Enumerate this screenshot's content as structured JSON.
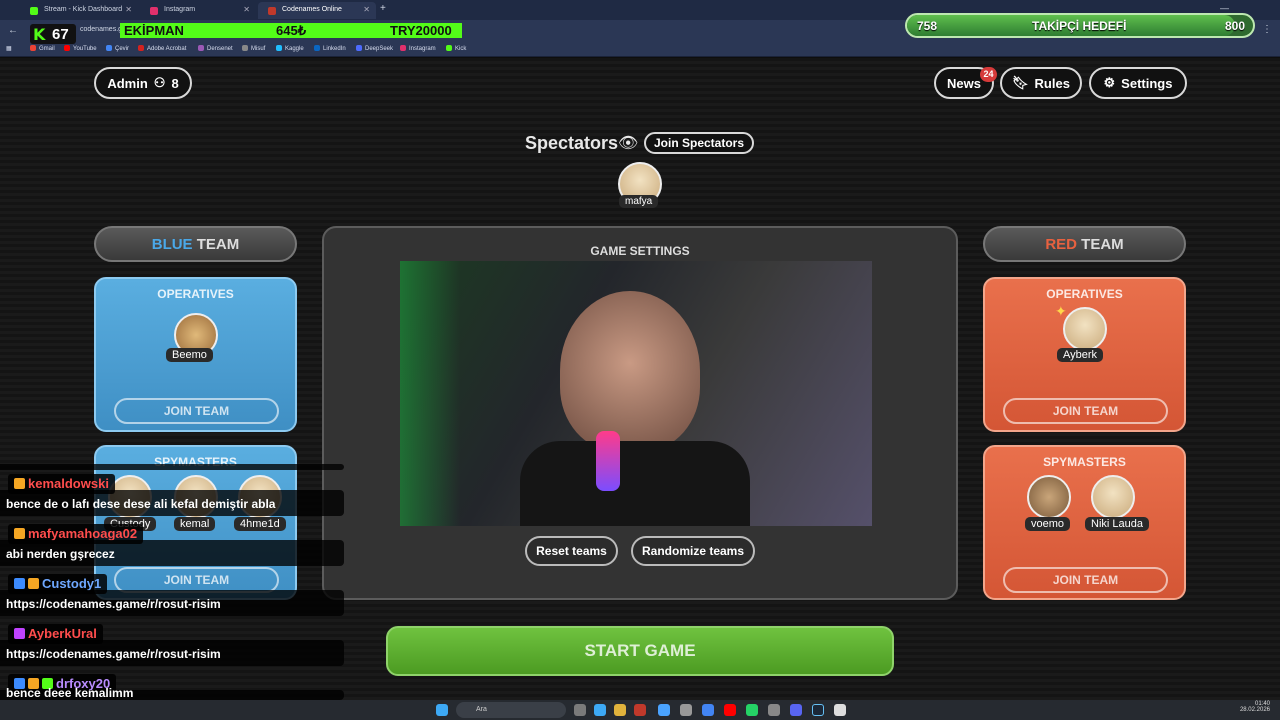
{
  "browser": {
    "tabs": [
      {
        "title": "Stream - Kick Dashboard",
        "color": "#53fc18"
      },
      {
        "title": "Instagram",
        "color": "#e1306c"
      },
      {
        "title": "Codenames Online",
        "color": "#c0392b"
      }
    ],
    "address_partial": "codenames.g",
    "bookmarks": [
      {
        "label": "Gmail",
        "color": "#ea4335"
      },
      {
        "label": "YouTube",
        "color": "#ff0000"
      },
      {
        "label": "Çevir",
        "color": "#4285f4"
      },
      {
        "label": "Adobe Acrobat",
        "color": "#d4221f"
      },
      {
        "label": "Densenet",
        "color": "#9b59b6"
      },
      {
        "label": "Misuf",
        "color": "#888888"
      },
      {
        "label": "Kaggle",
        "color": "#20beff"
      },
      {
        "label": "LinkedIn",
        "color": "#0a66c2"
      },
      {
        "label": "DeepSeek",
        "color": "#4d6bfe"
      },
      {
        "label": "Instagram",
        "color": "#e1306c"
      },
      {
        "label": "Kick",
        "color": "#53fc18"
      }
    ]
  },
  "overlay": {
    "kick_logo": "K",
    "viewer_count": "67",
    "goal_strip": {
      "label": "EKİPMAN",
      "amount": "645₺",
      "target": "TRY20000"
    },
    "follower_goal": {
      "current": "758",
      "label": "TAKİPÇİ HEDEFİ",
      "target": "800",
      "progress": 0.9475
    }
  },
  "header": {
    "admin_label": "Admin",
    "player_count": "8",
    "news_label": "News",
    "news_badge": "24",
    "rules_label": "Rules",
    "settings_label": "Settings"
  },
  "spectators": {
    "title": "Spectators",
    "join_label": "Join Spectators",
    "members": [
      "mafya"
    ]
  },
  "blue_team": {
    "title_accent": "BLUE",
    "title_rest": "TEAM",
    "operatives_title": "OPERATIVES",
    "operatives": [
      "Beemo"
    ],
    "join_label": "JOIN TEAM",
    "spymasters_title": "SPYMASTERS",
    "spymasters": [
      "Custody",
      "kemal",
      "4hme1d"
    ],
    "join_label_2": "JOIN TEAM"
  },
  "red_team": {
    "title_accent": "RED",
    "title_rest": "TEAM",
    "operatives_title": "OPERATIVES",
    "operatives": [
      "Ayberk"
    ],
    "join_label": "JOIN TEAM",
    "spymasters_title": "SPYMASTERS",
    "spymasters": [
      "voemo",
      "Niki Lauda"
    ],
    "join_label_2": "JOIN TEAM"
  },
  "game_settings": {
    "title": "GAME SETTINGS",
    "reset_label": "Reset teams",
    "randomize_label": "Randomize teams"
  },
  "start_label": "START GAME",
  "chat": [
    {
      "user": "kemaldowski",
      "color": "#ff4d4d",
      "message": "bence de o lafı dese dese ali kefal demiştir abla"
    },
    {
      "user": "mafyamahoaga02",
      "color": "#ff4d4d",
      "message": "abi nerden gşrecez"
    },
    {
      "user": "Custody1",
      "color": "#6fa8ff",
      "message": "https://codenames.game/r/rosut-risim"
    },
    {
      "user": "AyberkUral",
      "color": "#ff4d4d",
      "message": "https://codenames.game/r/rosut-risim"
    },
    {
      "user": "drfoxy20",
      "color": "#b98cff",
      "message": "bence deee kemalimm"
    }
  ],
  "taskbar": {
    "search_label": "Ara",
    "time": "01:40",
    "date": "28.02.2026"
  }
}
